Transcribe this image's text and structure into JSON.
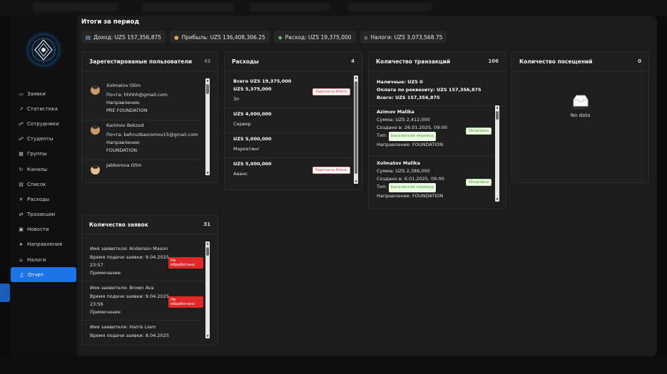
{
  "period_title": "Итоги за период",
  "summary": {
    "income": "Доход: UZS 157,356,875",
    "profit": "Прибыль: UZS 136,408,306.25",
    "expense": "Расход: UZS 19,375,000",
    "taxes": "Налоги: UZS 3,073,568.75"
  },
  "sidebar": {
    "items": [
      {
        "label": "Заявки",
        "icon": "inbox-icon"
      },
      {
        "label": "Статистика",
        "icon": "chart-line-icon"
      },
      {
        "label": "Сотрудники",
        "icon": "team-icon"
      },
      {
        "label": "Студенты",
        "icon": "students-icon"
      },
      {
        "label": "Группы",
        "icon": "groups-icon"
      },
      {
        "label": "Каналы",
        "icon": "channels-icon"
      },
      {
        "label": "Список",
        "icon": "list-icon"
      },
      {
        "label": "Расходы",
        "icon": "expenses-icon"
      },
      {
        "label": "Тразакции",
        "icon": "transactions-icon"
      },
      {
        "label": "Новости",
        "icon": "news-icon"
      },
      {
        "label": "Направления",
        "icon": "directions-icon"
      },
      {
        "label": "Налоги",
        "icon": "bank-icon"
      },
      {
        "label": "Отчет",
        "icon": "report-icon",
        "active": true
      }
    ]
  },
  "users_card": {
    "title": "Зарегестированые пользователи",
    "count": "43",
    "users": [
      {
        "name": "Xolmatov Olim",
        "email": "Почта: hhhhh@gmail.com",
        "direction_label": "Направление:",
        "direction": "PRE FOUNDATION"
      },
      {
        "name": "Karimov Bekzod",
        "email": "Почта: behruzbaxromov15@gmail.com",
        "direction_label": "Направление:",
        "direction": "FOUNDATION"
      },
      {
        "name": "Jabborova Olim",
        "email": "",
        "direction_label": "",
        "direction": ""
      }
    ]
  },
  "expenses_card": {
    "title": "Расходы",
    "count": "4",
    "total": "Всего UZS 19,375,000",
    "items": [
      {
        "amount": "UZS 5,375,000",
        "name": "Зп",
        "tag": "Зарплата Anton"
      },
      {
        "amount": "UZS 4,000,000",
        "name": "Сервер",
        "tag": ""
      },
      {
        "amount": "UZS 5,000,000",
        "name": "Маркетинг",
        "tag": ""
      },
      {
        "amount": "UZS 5,000,000",
        "name": "Аванс",
        "tag": "Зарплата Anton"
      }
    ]
  },
  "transactions_card": {
    "title": "Количество транзакций",
    "count": "106",
    "cash": "Наличные: UZS 0",
    "by_details": "Оплата по реквезиту: UZS 157,356,875",
    "total": "Всего: UZS 157,356,875",
    "items": [
      {
        "name": "Azimov Malika",
        "sum": "Сумма: UZS 2,412,000",
        "created": "Создано в: 26.01.2025, 09:00",
        "status": "Оплачено",
        "type_label": "Тип:",
        "type": "Банковский перевод",
        "direction": "Направление: FOUNDATION"
      },
      {
        "name": "Xolmatov Malika",
        "sum": "Сумма: UZS 2,386,000",
        "created": "Создано в: 6.01.2025, 09:00",
        "status": "Оплачено",
        "type_label": "Тип:",
        "type": "Банковский перевод",
        "direction": "Направление: FOUNDATION"
      }
    ]
  },
  "visits_card": {
    "title": "Количество посещений",
    "count": "0",
    "empty": "No data"
  },
  "applications_card": {
    "title": "Количество заявок",
    "count": "31",
    "items": [
      {
        "applicant": "Имя заявителя: Anderson Mason",
        "time1": "Время подачи заявки: 9.04.2025,",
        "time2": "23:57",
        "note": "Примечание:",
        "status": "Не обработано"
      },
      {
        "applicant": "Имя заявителя: Brown Ava",
        "time1": "Время подачи заявки: 9.04.2025,",
        "time2": "23:56",
        "note": "Примечание:",
        "status": "Не обработано"
      },
      {
        "applicant": "Имя заявителя: Harris Liam",
        "time1": "Время подачи заявки: 8.04.2025",
        "time2": "",
        "note": "",
        "status": ""
      }
    ]
  },
  "colors": {
    "accent": "#1e73e6",
    "status_red": "#e02828",
    "paid_green": "#3a9a2a"
  }
}
